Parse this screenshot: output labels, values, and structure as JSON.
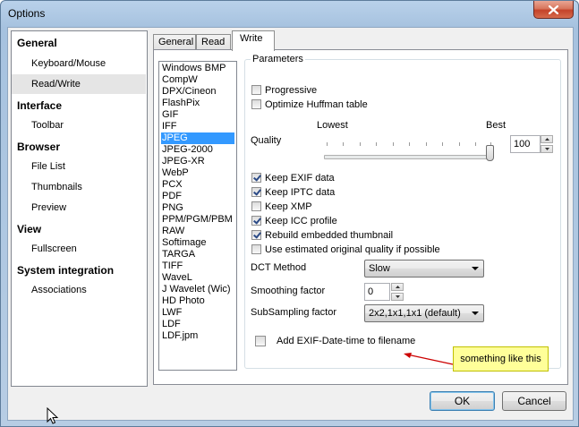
{
  "window": {
    "title": "Options"
  },
  "nav": {
    "sections": [
      {
        "label": "General",
        "items": [
          "Keyboard/Mouse",
          "Read/Write"
        ]
      },
      {
        "label": "Interface",
        "items": [
          "Toolbar"
        ]
      },
      {
        "label": "Browser",
        "items": [
          "File List",
          "Thumbnails",
          "Preview"
        ]
      },
      {
        "label": "View",
        "items": [
          "Fullscreen"
        ]
      },
      {
        "label": "System integration",
        "items": [
          "Associations"
        ]
      }
    ],
    "selected": "Read/Write"
  },
  "tabs": [
    "General",
    "Read",
    "Write"
  ],
  "active_tab": "Write",
  "formats": [
    "Windows BMP",
    "CompW",
    "DPX/Cineon",
    "FlashPix",
    "GIF",
    "IFF",
    "JPEG",
    "JPEG-2000",
    "JPEG-XR",
    "WebP",
    "PCX",
    "PDF",
    "PNG",
    "PPM/PGM/PBM",
    "RAW",
    "Softimage",
    "TARGA",
    "TIFF",
    "WaveL",
    "J Wavelet (Wic)",
    "HD Photo",
    "LWF",
    "LDF",
    "LDF.jpm"
  ],
  "selected_format": "JPEG",
  "params": {
    "legend": "Parameters",
    "progressive": {
      "label": "Progressive",
      "checked": false
    },
    "optimize_huffman": {
      "label": "Optimize Huffman table",
      "checked": false
    },
    "quality": {
      "label": "Quality",
      "min_label": "Lowest",
      "max_label": "Best",
      "value": "100",
      "slider_fraction": 1.0
    },
    "checks": [
      {
        "label": "Keep EXIF data",
        "checked": true
      },
      {
        "label": "Keep IPTC data",
        "checked": true
      },
      {
        "label": "Keep XMP",
        "checked": false
      },
      {
        "label": "Keep ICC profile",
        "checked": true
      },
      {
        "label": "Rebuild embedded thumbnail",
        "checked": true
      },
      {
        "label": "Use estimated original quality if possible",
        "checked": false
      }
    ],
    "dct_method": {
      "label": "DCT Method",
      "value": "Slow"
    },
    "smoothing": {
      "label": "Smoothing factor",
      "value": "0"
    },
    "subsampling": {
      "label": "SubSampling factor",
      "value": "2x2,1x1,1x1 (default)"
    },
    "exif_date": {
      "label": "Add EXIF-Date-time to filename",
      "checked": false
    }
  },
  "callout": {
    "text": "something like this",
    "color": "#ffff99",
    "arrow_color": "#cc0000"
  },
  "buttons": {
    "ok": "OK",
    "cancel": "Cancel"
  },
  "colors": {
    "selection": "#3399ff",
    "title_gradient": "#b9d1ea",
    "close": "#c4432a"
  }
}
